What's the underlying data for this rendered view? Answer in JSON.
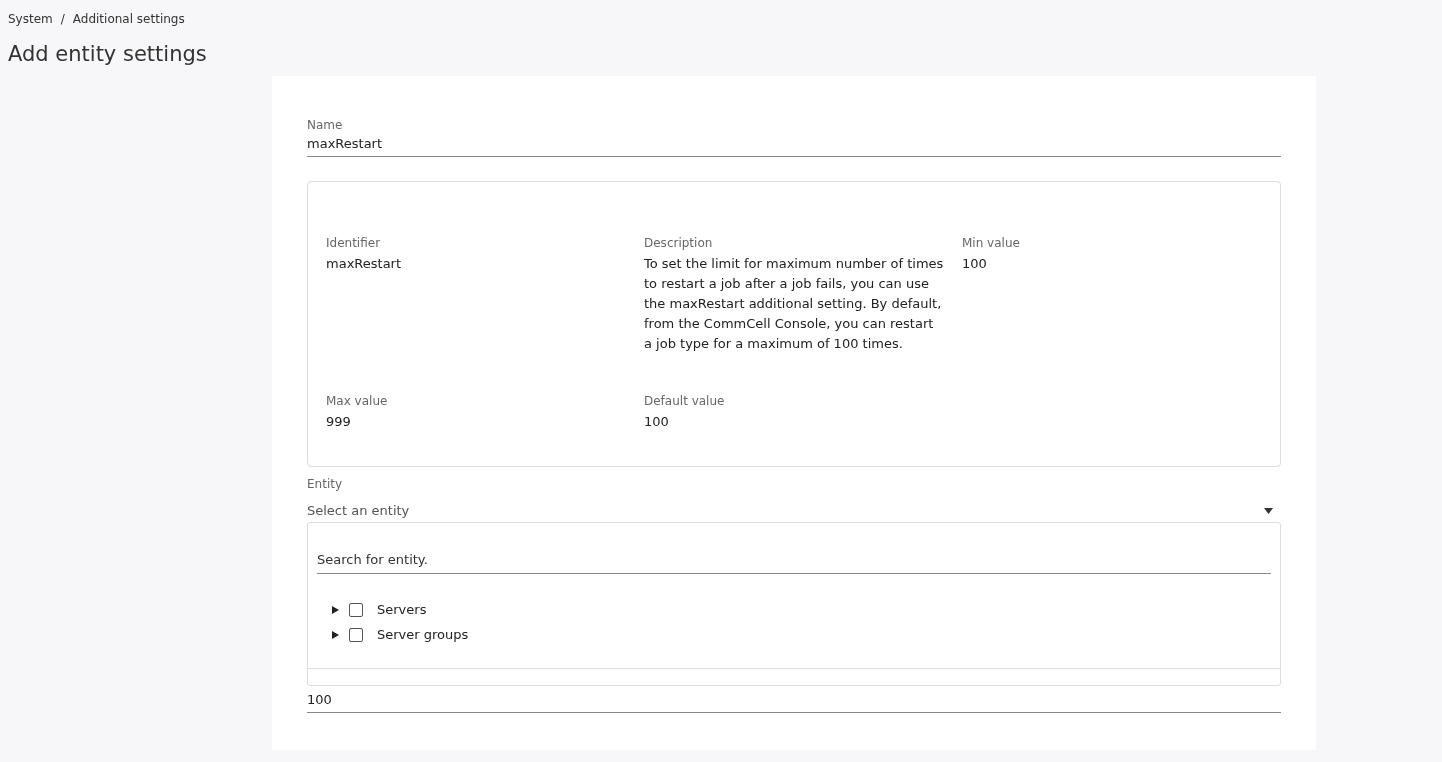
{
  "breadcrumb": [
    {
      "label": "System"
    },
    {
      "label": "Additional settings"
    }
  ],
  "breadcrumb_separator": "/",
  "title": "Add entity settings",
  "name_field": {
    "label": "Name",
    "value": "maxRestart"
  },
  "details": [
    {
      "label": "Identifier",
      "value": "maxRestart"
    },
    {
      "label": "Description",
      "value": "To set the limit for maximum number of times to restart a job after a job fails, you can use the maxRestart additional setting. By default, from the CommCell Console, you can restart a job type for a maximum of 100 times."
    },
    {
      "label": "Min value",
      "value": "100"
    },
    {
      "label": "Max value",
      "value": "999"
    },
    {
      "label": "Default value",
      "value": "100"
    }
  ],
  "entity_field": {
    "label": "Entity",
    "placeholder": "Select an entity",
    "expanded": true
  },
  "entity_dropdown": {
    "search": {
      "placeholder": "Search for entity."
    },
    "items": [
      {
        "label": "Servers",
        "expanded": false,
        "checked": false
      },
      {
        "label": "Server groups",
        "expanded": false,
        "checked": false
      }
    ]
  },
  "value_field": {
    "value": "100"
  }
}
